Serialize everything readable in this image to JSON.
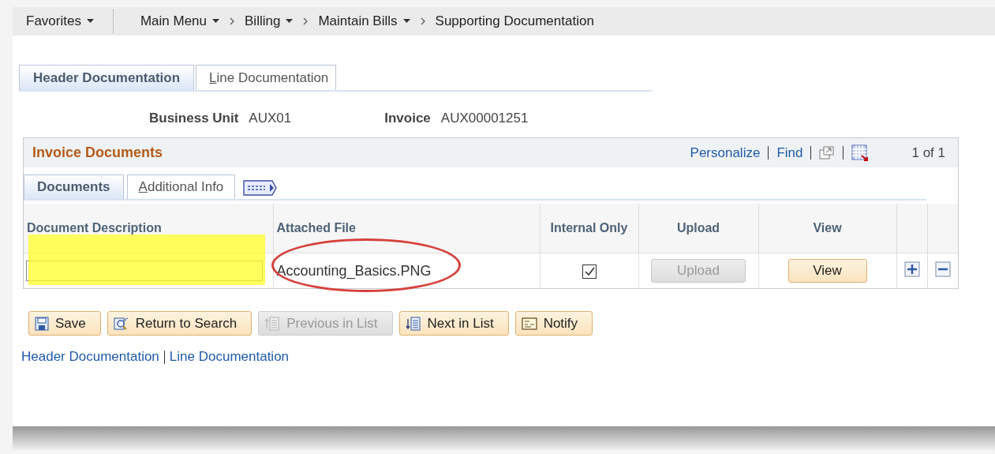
{
  "breadcrumbs": [
    {
      "label": "Favorites",
      "menu": true,
      "sep_before": false
    },
    {
      "label": "Main Menu",
      "menu": true,
      "sep_before": false
    },
    {
      "label": "Billing",
      "menu": true,
      "sep_before": true
    },
    {
      "label": "Maintain Bills",
      "menu": true,
      "sep_before": true
    },
    {
      "label": "Supporting Documentation",
      "menu": false,
      "sep_before": true
    }
  ],
  "page_tabs": [
    {
      "label": "Header Documentation",
      "selected": true
    },
    {
      "label": "Line Documentation",
      "selected": false
    }
  ],
  "fields": [
    {
      "label": "Business Unit",
      "value": "AUX01"
    },
    {
      "label": "Invoice",
      "value": "AUX00001251"
    }
  ],
  "grid": {
    "title": "Invoice Documents",
    "links": [
      "Personalize",
      "Find"
    ],
    "count": "1 of 1",
    "tabs": [
      {
        "label": "Documents",
        "selected": true
      },
      {
        "label": "Additional Info",
        "selected": false
      }
    ],
    "columns": [
      "Document Description",
      "Attached File",
      "Internal Only",
      "Upload",
      "View"
    ],
    "rows": [
      {
        "description": "",
        "file": "Accounting_Basics.PNG",
        "internal_only": true,
        "upload": {
          "label": "Upload",
          "disabled": true
        },
        "view": {
          "label": "View",
          "disabled": false
        }
      }
    ]
  },
  "buttons": [
    {
      "label": "Save",
      "kind": "save",
      "disabled": false
    },
    {
      "label": "Return to Search",
      "kind": "search",
      "disabled": false
    },
    {
      "label": "Previous in List",
      "kind": "prev",
      "disabled": true
    },
    {
      "label": "Next in List",
      "kind": "next",
      "disabled": false
    },
    {
      "label": "Notify",
      "kind": "notify",
      "disabled": false
    }
  ],
  "footer_links": [
    "Header Documentation",
    "Line Documentation"
  ]
}
